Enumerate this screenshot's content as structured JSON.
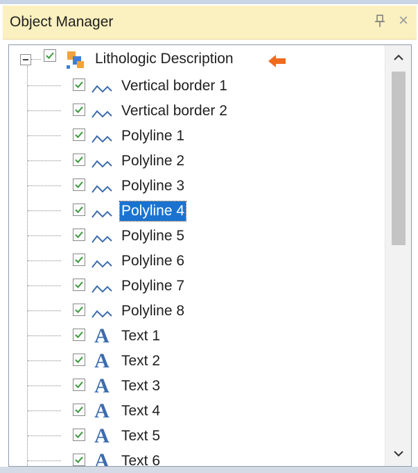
{
  "window": {
    "title": "Object Manager",
    "pin_icon": "pin-icon",
    "close_icon": "close-icon",
    "close_glyph": "×"
  },
  "tree": {
    "root": {
      "label": "Lithologic Description",
      "checked": true,
      "expanded": true,
      "icon": "layer-stack-icon",
      "marker_icon": "orange-arrow-icon",
      "marker_color": "#f06b1d"
    },
    "children": [
      {
        "label": "Vertical border 1",
        "checked": true,
        "icon": "polyline-icon",
        "selected": false
      },
      {
        "label": "Vertical border 2",
        "checked": true,
        "icon": "polyline-icon",
        "selected": false
      },
      {
        "label": "Polyline 1",
        "checked": true,
        "icon": "polyline-icon",
        "selected": false
      },
      {
        "label": "Polyline 2",
        "checked": true,
        "icon": "polyline-icon",
        "selected": false
      },
      {
        "label": "Polyline 3",
        "checked": true,
        "icon": "polyline-icon",
        "selected": false
      },
      {
        "label": "Polyline 4",
        "checked": true,
        "icon": "polyline-icon",
        "selected": true
      },
      {
        "label": "Polyline 5",
        "checked": true,
        "icon": "polyline-icon",
        "selected": false
      },
      {
        "label": "Polyline 6",
        "checked": true,
        "icon": "polyline-icon",
        "selected": false
      },
      {
        "label": "Polyline 7",
        "checked": true,
        "icon": "polyline-icon",
        "selected": false
      },
      {
        "label": "Polyline 8",
        "checked": true,
        "icon": "polyline-icon",
        "selected": false
      },
      {
        "label": "Text 1",
        "checked": true,
        "icon": "text-icon",
        "selected": false
      },
      {
        "label": "Text 2",
        "checked": true,
        "icon": "text-icon",
        "selected": false
      },
      {
        "label": "Text 3",
        "checked": true,
        "icon": "text-icon",
        "selected": false
      },
      {
        "label": "Text 4",
        "checked": true,
        "icon": "text-icon",
        "selected": false
      },
      {
        "label": "Text 5",
        "checked": true,
        "icon": "text-icon",
        "selected": false
      },
      {
        "label": "Text 6",
        "checked": true,
        "icon": "text-icon",
        "selected": false
      }
    ]
  },
  "text_icon_glyph": "A",
  "scrollbar": {
    "up_icon": "chevron-up-icon",
    "down_icon": "chevron-down-icon"
  },
  "colors": {
    "title_bar": "#fbf0bf",
    "selection": "#1a73d1",
    "polyline_icon": "#3c6cae",
    "check_mark": "#3a9a3a"
  }
}
